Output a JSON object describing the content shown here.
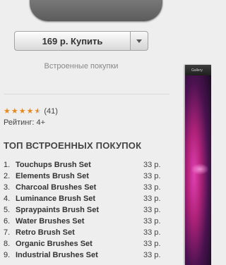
{
  "buy": {
    "price_label": "169 р. Купить"
  },
  "iap_note": "Встроенные покупки",
  "rating": {
    "stars": 4.5,
    "count": "(41)",
    "age": "Рейтинг: 4+"
  },
  "top_iap": {
    "title": "ТОП ВСТРОЕННЫХ ПОКУПОК",
    "items": [
      {
        "num": "1.",
        "name": "Touchups Brush Set",
        "price": "33 р."
      },
      {
        "num": "2.",
        "name": "Elements Brush Set",
        "price": "33 р."
      },
      {
        "num": "3.",
        "name": "Charcoal Brushes Set",
        "price": "33 р."
      },
      {
        "num": "4.",
        "name": "Luminance Brush Set",
        "price": "33 р."
      },
      {
        "num": "5.",
        "name": "Spraypaints Brush Set",
        "price": "33 р."
      },
      {
        "num": "6.",
        "name": "Water Brushes Set",
        "price": "33 р."
      },
      {
        "num": "7.",
        "name": "Retro Brush Set",
        "price": "33 р."
      },
      {
        "num": "8.",
        "name": "Organic Brushes Set",
        "price": "33 р."
      },
      {
        "num": "9.",
        "name": "Industrial Brushes Set",
        "price": "33 р."
      }
    ]
  },
  "screenshot": {
    "bar_label": "Gallery"
  },
  "colors": {
    "star": "#e68a1e",
    "background": "#eeeeee"
  }
}
